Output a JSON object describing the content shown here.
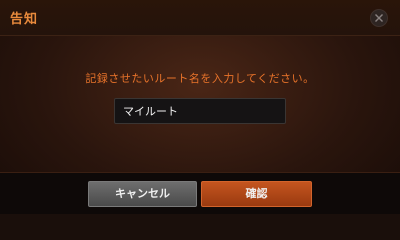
{
  "dialog": {
    "title": "告知",
    "close_icon": "close-icon",
    "message": "記録させたいルート名を入力してください。",
    "input": {
      "value": "マイルート"
    },
    "buttons": {
      "cancel_label": "キャンセル",
      "confirm_label": "確認"
    }
  },
  "colors": {
    "accent": "#e8732a",
    "confirm_button": "#b4481a",
    "cancel_button": "#5c5c5c"
  }
}
